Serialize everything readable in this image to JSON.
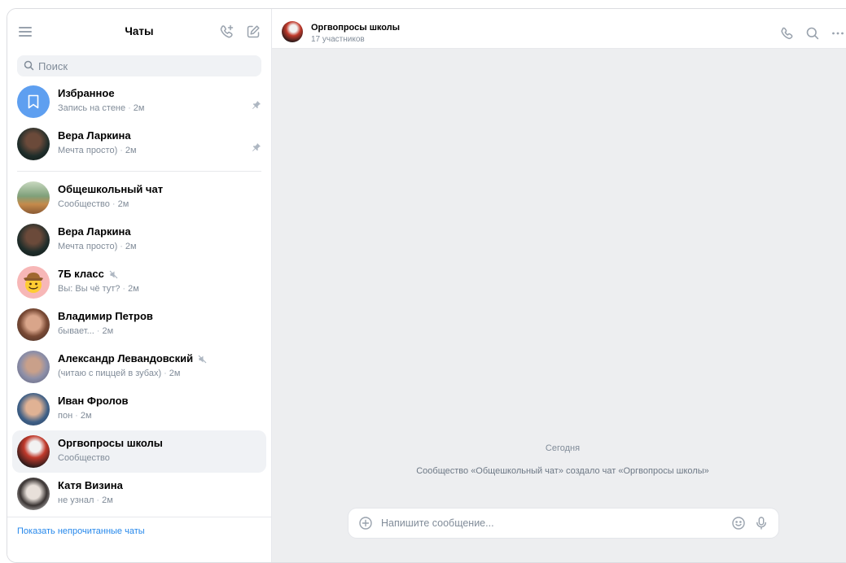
{
  "sidebar": {
    "title": "Чаты",
    "search_placeholder": "Поиск",
    "pinned": [
      {
        "name": "Избранное",
        "message": "Запись на стене",
        "time": "2м"
      },
      {
        "name": "Вера Ларкина",
        "message": "Мечта просто)",
        "time": "2м"
      }
    ],
    "chats": [
      {
        "name": "Общешкольный чат",
        "message": "Сообщество",
        "time": "2м"
      },
      {
        "name": "Вера Ларкина",
        "message": "Мечта просто)",
        "time": "2м"
      },
      {
        "name": "7Б класс",
        "prefix": "Вы:",
        "message": "Вы чё тут?",
        "time": "2м"
      },
      {
        "name": "Владимир Петров",
        "message": "бывает...",
        "time": "2м"
      },
      {
        "name": "Александр Левандовский",
        "message": "(читаю с пиццей в зубах)",
        "time": "2м"
      },
      {
        "name": "Иван Фролов",
        "message": "пон",
        "time": "2м"
      },
      {
        "name": "Оргвопросы школы",
        "message": "Сообщество"
      },
      {
        "name": "Катя Визина",
        "message": "не узнал",
        "time": "2м"
      }
    ],
    "footer_link": "Показать непрочитанные чаты"
  },
  "conversation": {
    "title": "Оргвопросы школы",
    "subtitle": "17 участников",
    "date_separator": "Сегодня",
    "system_message": "Сообщество «Общешкольный чат» создало чат «Оргвопросы школы»",
    "composer_placeholder": "Напишите сообщение..."
  },
  "colors": {
    "accent": "#2688eb",
    "favorites_avatar": "#5e9ff0",
    "secondary_text": "#818c99",
    "main_background": "#edeef0"
  },
  "icons": [
    "menu-icon",
    "add-call-icon",
    "compose-icon",
    "search-icon",
    "bookmark-icon",
    "pin-icon",
    "mute-icon",
    "phone-icon",
    "more-icon",
    "add-attachment-icon",
    "emoji-icon",
    "microphone-icon"
  ]
}
